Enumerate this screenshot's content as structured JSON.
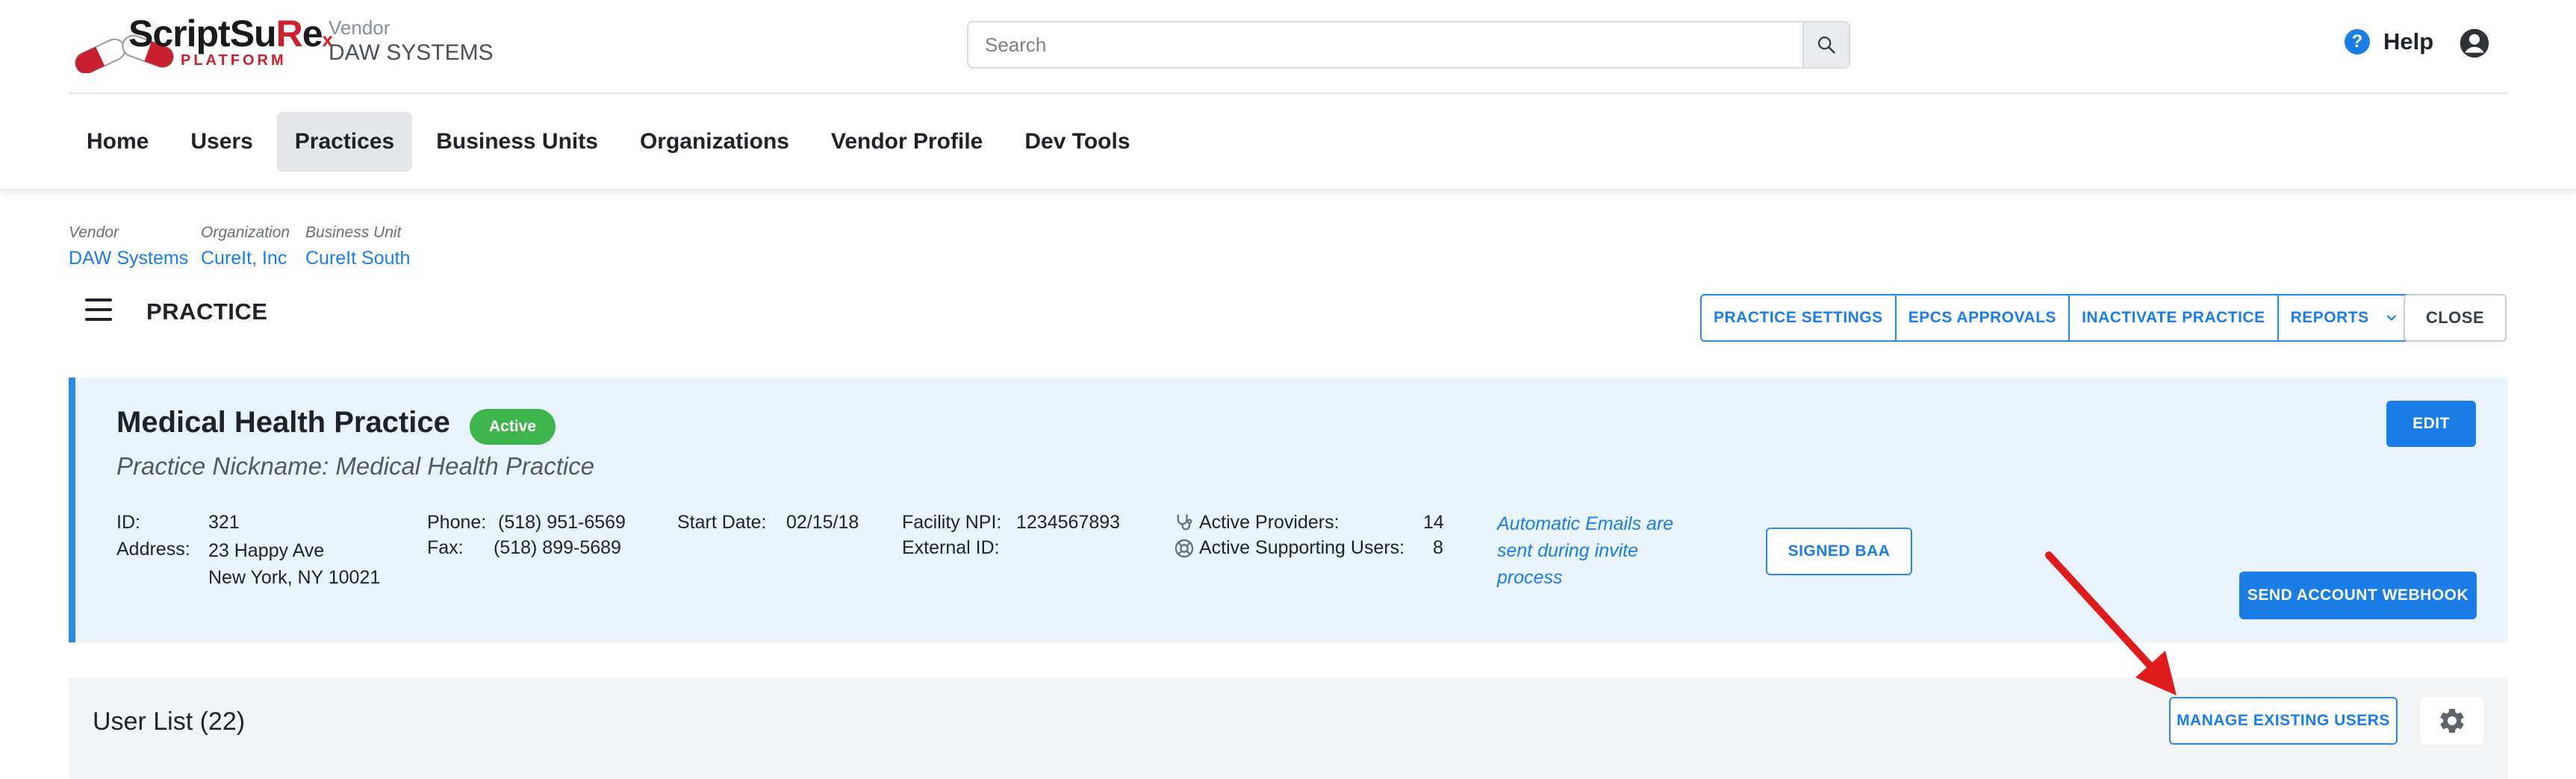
{
  "header": {
    "logo": {
      "word_main": "ScriptSu",
      "word_rx": "R",
      "word_end": "e",
      "x_mark": "x",
      "sub": "PLATFORM"
    },
    "vendor_label": "Vendor",
    "vendor_name": "DAW SYSTEMS",
    "search_placeholder": "Search",
    "help_label": "Help",
    "help_icon_glyph": "?"
  },
  "nav": [
    {
      "label": "Home",
      "active": false
    },
    {
      "label": "Users",
      "active": false
    },
    {
      "label": "Practices",
      "active": true
    },
    {
      "label": "Business Units",
      "active": false
    },
    {
      "label": "Organizations",
      "active": false
    },
    {
      "label": "Vendor Profile",
      "active": false
    },
    {
      "label": "Dev Tools",
      "active": false
    }
  ],
  "breadcrumb": {
    "vendor": {
      "label": "Vendor",
      "value": "DAW Systems"
    },
    "organization": {
      "label": "Organization",
      "value": "CureIt, Inc"
    },
    "business_unit": {
      "label": "Business Unit",
      "value": "CureIt South"
    }
  },
  "page": {
    "title": "PRACTICE",
    "actions": [
      "PRACTICE SETTINGS",
      "EPCS APPROVALS",
      "INACTIVATE PRACTICE",
      "REPORTS"
    ],
    "close_label": "CLOSE"
  },
  "practice": {
    "name": "Medical Health Practice",
    "status": "Active",
    "nickname": "Practice Nickname: Medical Health Practice",
    "id_label": "ID:",
    "id": "321",
    "address_label": "Address:",
    "address_line1": "23 Happy Ave",
    "address_line2": "New York, NY 10021",
    "phone_label": "Phone:",
    "phone": "(518) 951-6569",
    "fax_label": "Fax:",
    "fax": "(518) 899-5689",
    "start_date_label": "Start Date:",
    "start_date": "02/15/18",
    "npi_label": "Facility NPI:",
    "npi": "1234567893",
    "external_id_label": "External ID:",
    "external_id": "",
    "active_providers_label": "Active Providers:",
    "active_providers": "14",
    "active_supporting_label": "Active Supporting Users:",
    "active_supporting": "8",
    "auto_email_note": "Automatic Emails are sent during invite process",
    "signed_baa_label": "SIGNED BAA",
    "edit_label": "EDIT",
    "webhook_label": "SEND ACCOUNT WEBHOOK"
  },
  "user_list": {
    "title": "User List (22)",
    "manage_label": "MANAGE EXISTING USERS"
  },
  "colors": {
    "accent": "#1a7ee6",
    "active_badge": "#3fb44c",
    "card_bg": "#eaf4fd",
    "arrow": "#e01b1b",
    "brand_red": "#d0202f"
  }
}
